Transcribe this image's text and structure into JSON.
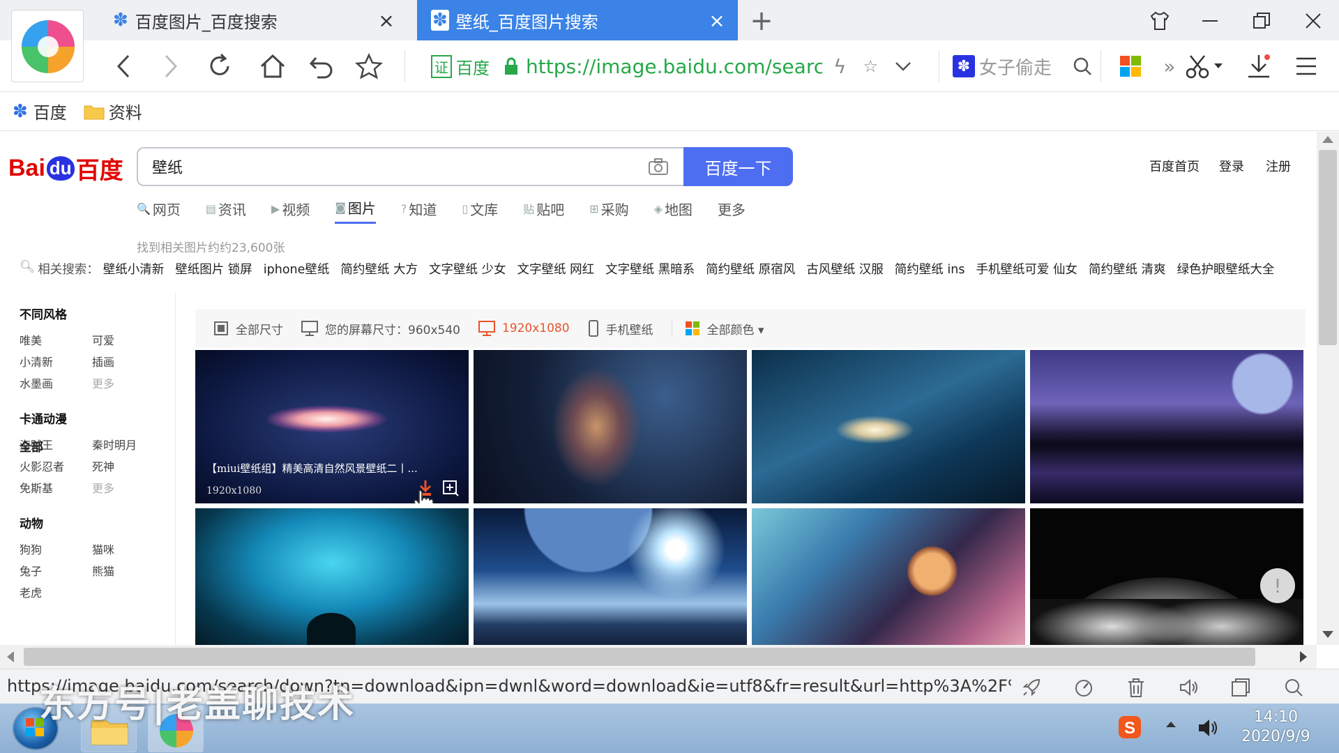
{
  "tabs": [
    {
      "title": "百度图片_百度搜索",
      "close": "×"
    },
    {
      "title": "壁纸_百度图片搜索",
      "close": "×"
    }
  ],
  "new_tab": "+",
  "toolbar": {
    "cert_label": "证",
    "cert_text": "百度",
    "url": "https://image.baidu.com/searc",
    "top_search": "女子偷走"
  },
  "bookmarks": [
    {
      "label": "百度",
      "icon": "baidu-paw-icon"
    },
    {
      "label": "资料",
      "icon": "folder-icon"
    }
  ],
  "baidu": {
    "logo_bai": "Bai",
    "logo_du": "du",
    "logo_cn": "百度",
    "query": "壁纸",
    "search_btn": "百度一下",
    "top_links": [
      "百度首页",
      "登录",
      "注册"
    ],
    "nav_tabs": [
      {
        "icon": "🔍",
        "label": "网页"
      },
      {
        "icon": "▤",
        "label": "资讯"
      },
      {
        "icon": "▶",
        "label": "视频"
      },
      {
        "icon": "◙",
        "label": "图片",
        "active": true
      },
      {
        "icon": "?",
        "label": "知道"
      },
      {
        "icon": "▯",
        "label": "文库"
      },
      {
        "icon": "贴",
        "label": "贴吧"
      },
      {
        "icon": "⊞",
        "label": "采购"
      },
      {
        "icon": "◈",
        "label": "地图"
      },
      {
        "icon": "",
        "label": "更多"
      }
    ],
    "result_count": "找到相关图片约约23,600张",
    "related_label": "相关搜索：",
    "related": [
      "壁纸小清新",
      "壁纸图片 锁屏",
      "iphone壁纸",
      "简约壁纸 大方",
      "文字壁纸 少女",
      "文字壁纸 网红",
      "文字壁纸 黑暗系",
      "简约壁纸 原宿风",
      "古风壁纸 汉服",
      "简约壁纸 ins",
      "手机壁纸可爱 仙女",
      "简约壁纸 清爽",
      "绿色护眼壁纸大全"
    ]
  },
  "sidebar": {
    "all": "全部",
    "sections": [
      {
        "title": "不同风格",
        "items": [
          "唯美",
          "可爱",
          "小清新",
          "插画",
          "水墨画",
          "更多"
        ]
      },
      {
        "title": "卡通动漫",
        "items": [
          "海贼王",
          "秦时明月",
          "火影忍者",
          "死神",
          "免斯基",
          "更多"
        ]
      },
      {
        "title": "动物",
        "items": [
          "狗狗",
          "猫咪",
          "兔子",
          "熊猫",
          "老虎"
        ]
      }
    ]
  },
  "filters": [
    {
      "icon": "resize-icon",
      "label": "全部尺寸"
    },
    {
      "icon": "monitor-icon",
      "label": "您的屏幕尺寸：960x540"
    },
    {
      "icon": "desktop-icon",
      "label": "1920x1080",
      "active": true
    },
    {
      "icon": "phone-icon",
      "label": "手机壁纸"
    },
    {
      "icon": "color-grid-icon",
      "label": "全部颜色 ▾"
    }
  ],
  "thumbs": {
    "caption": "【miui壁纸组】精美高清自然风景壁纸二丨...",
    "size": "1920x1080"
  },
  "status_url": "https://image.baidu.com/search/down?tn=download&ipn=dwnl&word=download&ie=utf8&fr=result&url=http%3A%2F%...",
  "taskbar": {
    "time": "14:10",
    "date": "2020/9/9"
  },
  "watermark": "东方号|老盖聊技术",
  "colors": {
    "accent": "#3b83e6",
    "baidu_blue": "#4e6ef2",
    "baidu_red": "#e10602",
    "active_filter": "#e8532b"
  }
}
